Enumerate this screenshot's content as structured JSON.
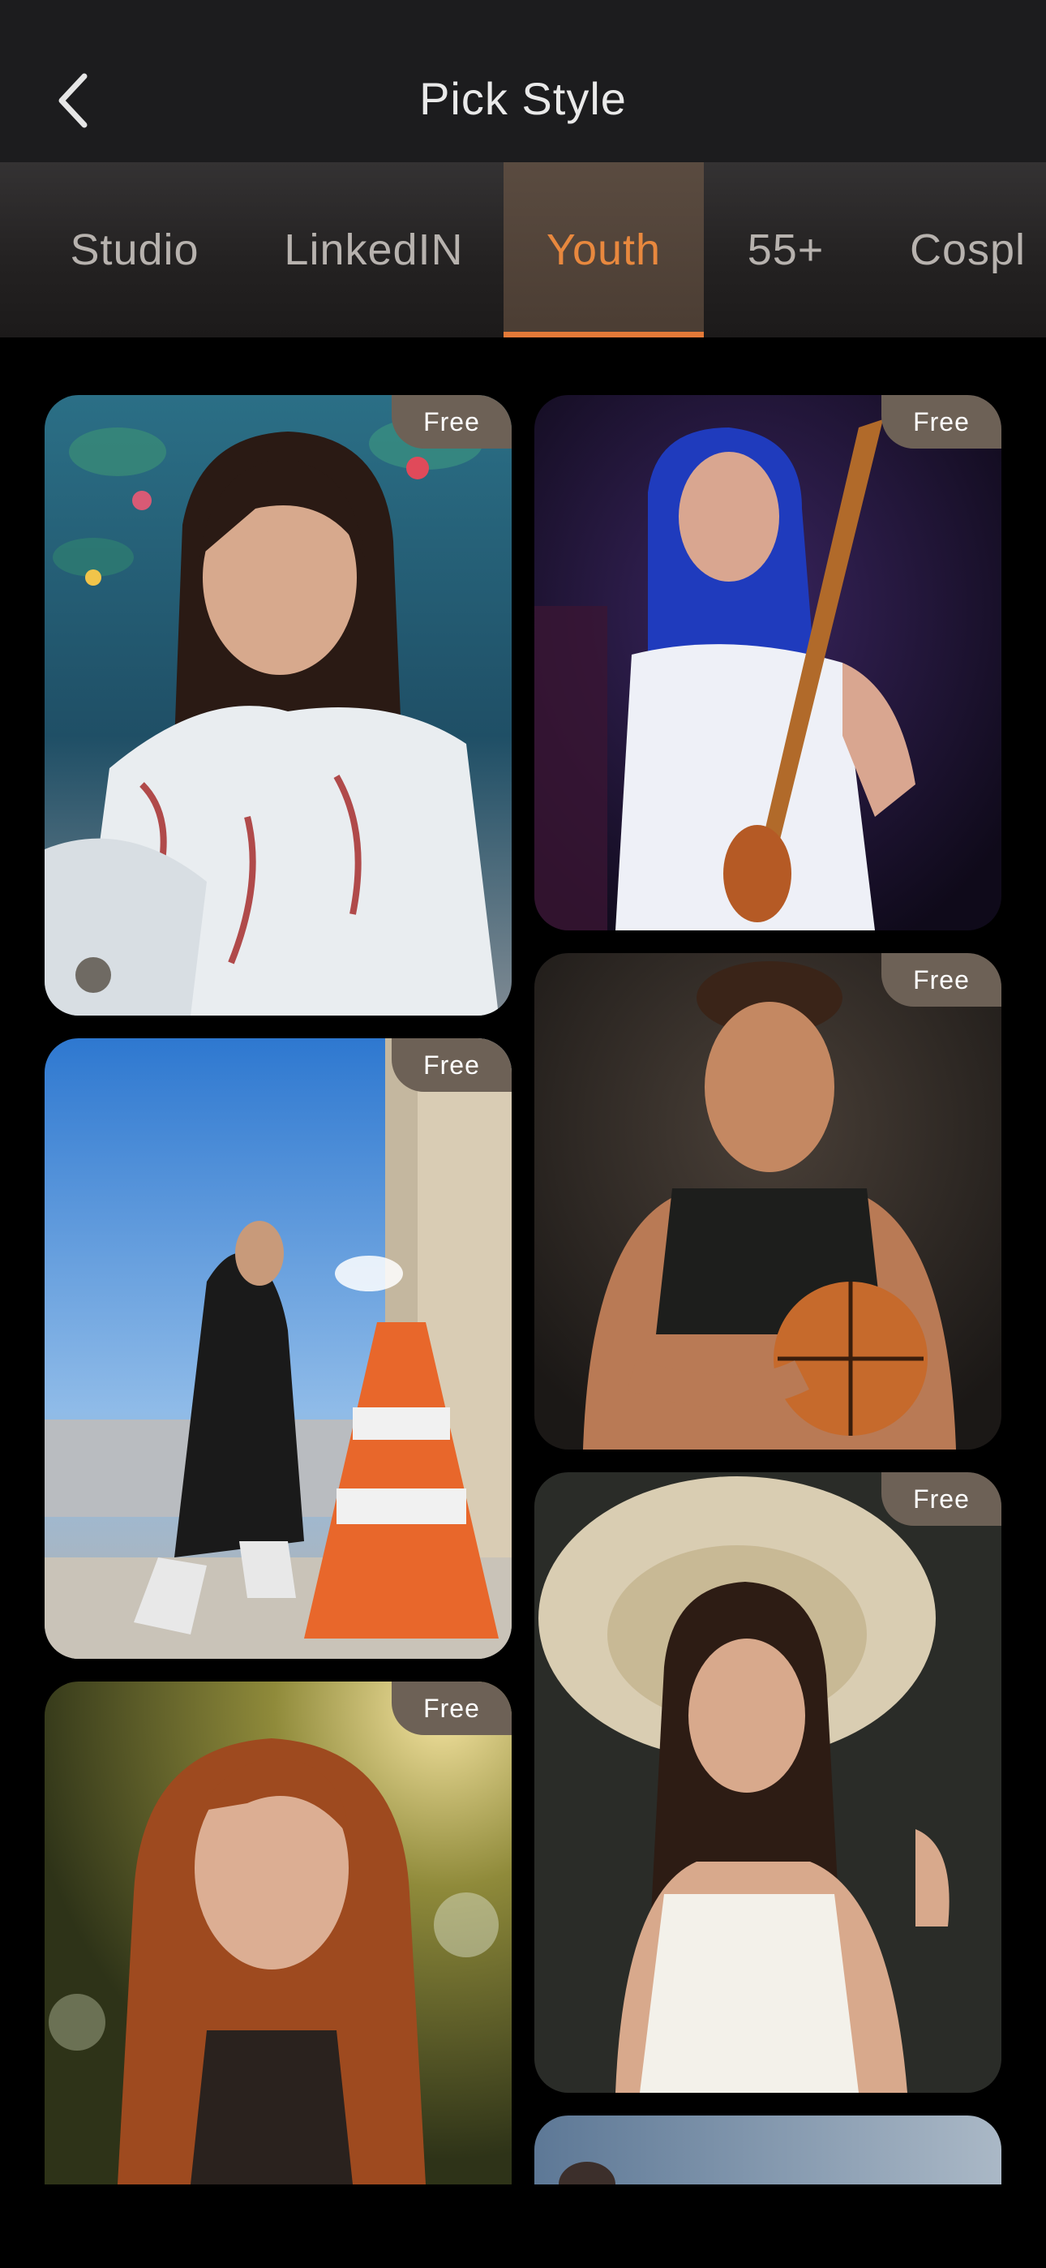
{
  "header": {
    "title": "Pick Style"
  },
  "tabs": [
    {
      "label": "Studio"
    },
    {
      "label": "LinkedIN"
    },
    {
      "label": "Youth"
    },
    {
      "label": "55+"
    },
    {
      "label": "Cospl"
    }
  ],
  "active_tab": "Youth",
  "cards": [
    {
      "badge": "Free",
      "subject": "woman in floral dress by lily pond"
    },
    {
      "badge": "Free",
      "subject": "woman playing guitar on stage"
    },
    {
      "badge": "Free",
      "subject": "man holding basketball"
    },
    {
      "badge": "Free",
      "subject": "woman crouching next to traffic cone"
    },
    {
      "badge": "Free",
      "subject": "woman in sun hat and white top"
    },
    {
      "badge": "Free",
      "subject": "red-haired woman in golden light"
    }
  ],
  "colors": {
    "accent": "#e57a38",
    "badge": "#6d6156",
    "background": "#000000"
  }
}
